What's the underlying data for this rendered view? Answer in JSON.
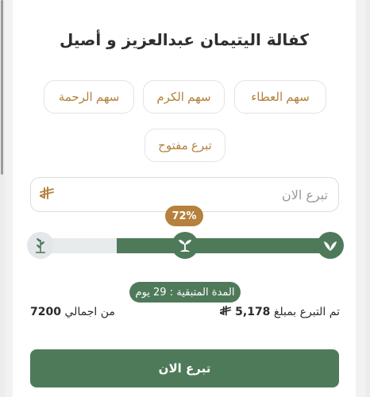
{
  "card": {
    "title": "كفالة اليتيمان عبدالعزيز و أصيل"
  },
  "options": [
    {
      "label": "سهم العطاء"
    },
    {
      "label": "سهم الكرم"
    },
    {
      "label": "سهم الرحمة"
    },
    {
      "label": "تبرع مفتوح"
    }
  ],
  "amount": {
    "placeholder": "تبرع الان",
    "value": "",
    "currency_symbol": "⃁"
  },
  "progress": {
    "percent": 72,
    "percent_label": "72%",
    "colors": {
      "fill": "#4f7a5a",
      "track": "#e7ebee",
      "badge": "#b5813d"
    },
    "milestone_icons": [
      "leaves-icon",
      "sprout-icon",
      "seedling-icon"
    ]
  },
  "remaining": {
    "label": "المدة المتبقية : 29 يوم"
  },
  "stats": {
    "donated_prefix": "تم التبرع بمبلغ",
    "donated_amount": "5,178",
    "total_prefix": "من اجمالي",
    "total_amount": "7200"
  },
  "actions": {
    "donate_label": "تبرع الان"
  },
  "colors": {
    "primary": "#4f7a5a",
    "accent": "#b5813d"
  }
}
